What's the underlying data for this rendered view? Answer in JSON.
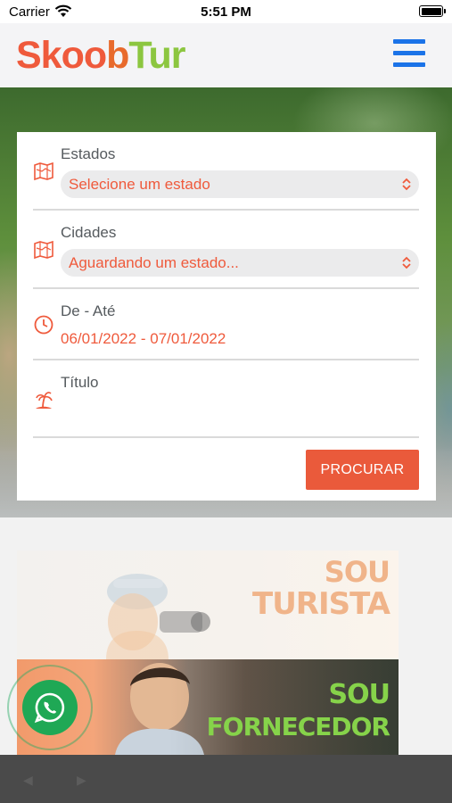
{
  "status_bar": {
    "carrier": "Carrier",
    "time": "5:51 PM"
  },
  "header": {
    "logo": {
      "part1": "Skoo",
      "part2": "b",
      "part3": "Tur"
    },
    "menu_icon": "hamburger-menu-icon"
  },
  "search_form": {
    "states": {
      "label": "Estados",
      "value": "Selecione um estado",
      "icon": "map-icon"
    },
    "cities": {
      "label": "Cidades",
      "value": "Aguardando um estado...",
      "icon": "map-icon"
    },
    "dates": {
      "label": "De - Até",
      "from": "06/01/2022",
      "separator": "-",
      "to": "07/01/2022",
      "icon": "clock-icon"
    },
    "title": {
      "label": "Título",
      "value": "",
      "icon": "palm-island-icon"
    },
    "search_button": "PROCURAR"
  },
  "banners": {
    "tourist": {
      "line1": "SOU",
      "line2": "TURISTA"
    },
    "provider": {
      "line1": "SOU",
      "line2": "FORNECEDOR"
    }
  },
  "whatsapp": {
    "icon": "whatsapp-icon"
  },
  "colors": {
    "accent": "#ea5a3b",
    "menu": "#1b73e8",
    "logo_green": "#8cc640",
    "whatsapp": "#1fa855"
  }
}
